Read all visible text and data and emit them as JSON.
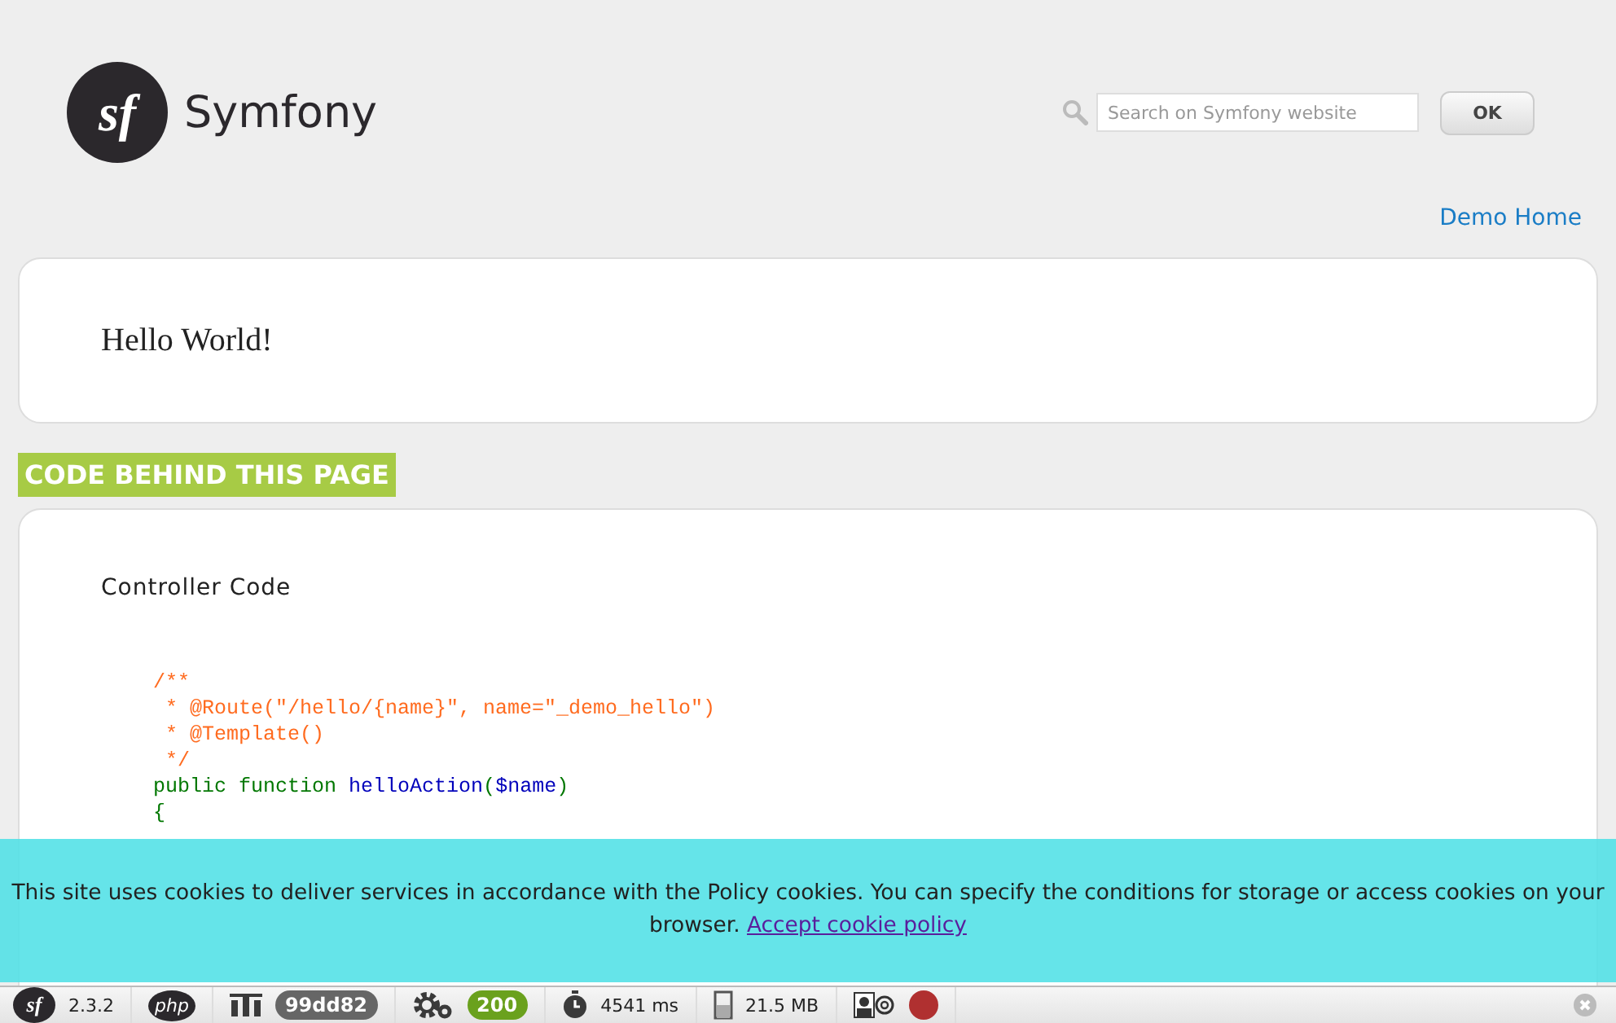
{
  "header": {
    "logo_mark": "sf",
    "logo_text": "Symfony",
    "search": {
      "placeholder": "Search on Symfony website"
    },
    "search_button": "OK"
  },
  "nav_link": "Demo Home",
  "greeting": "Hello World!",
  "section_label": "CODE BEHIND THIS PAGE",
  "code_card": {
    "title": "Controller Code",
    "lines": [
      [
        {
          "kind": "comment",
          "text": "/**"
        }
      ],
      [
        {
          "kind": "comment",
          "text": " * @Route(\"/hello/{name}\", name=\"_demo_hello\")"
        }
      ],
      [
        {
          "kind": "comment",
          "text": " * @Template()"
        }
      ],
      [
        {
          "kind": "comment",
          "text": " */"
        }
      ],
      [
        {
          "kind": "keyword",
          "text": "public function "
        },
        {
          "kind": "name",
          "text": "helloAction"
        },
        {
          "kind": "keyword",
          "text": "("
        },
        {
          "kind": "var",
          "text": "$name"
        },
        {
          "kind": "keyword",
          "text": ")"
        }
      ],
      [
        {
          "kind": "keyword",
          "text": "{"
        }
      ]
    ]
  },
  "cookie_banner": {
    "text": "This site uses cookies to deliver services in accordance with the Policy cookies. You can specify the conditions for storage or access cookies on your browser.",
    "link": "Accept cookie policy"
  },
  "toolbar": {
    "logo_mark": "sf",
    "version": "2.3.2",
    "php_label": "php",
    "token": "99dd82",
    "status": "200",
    "time": "4541 ms",
    "memory": "21.5 MB"
  }
}
